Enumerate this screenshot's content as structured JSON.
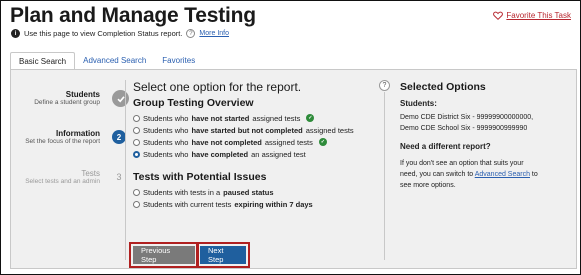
{
  "header": {
    "title": "Plan and Manage Testing",
    "subtitle": "Use this page to view Completion Status report.",
    "more_info": "More Info",
    "favorite": "Favorite This Task"
  },
  "tabs": [
    {
      "label": "Basic Search",
      "active": true
    },
    {
      "label": "Advanced Search",
      "active": false
    },
    {
      "label": "Favorites",
      "active": false
    }
  ],
  "steps": [
    {
      "title": "Students",
      "sub": "Define a student group",
      "marker": "",
      "state": "done"
    },
    {
      "title": "Information",
      "sub": "Set the focus of the report",
      "marker": "2",
      "state": "current"
    },
    {
      "title": "Tests",
      "sub": "Select tests and an admin",
      "marker": "3",
      "state": "todo"
    }
  ],
  "main": {
    "heading": "Select one option for the report.",
    "group1_title": "Group Testing Overview",
    "group1_options": [
      {
        "pre": "Students who ",
        "bold": "have not started",
        "post": " assigned tests",
        "icon": true,
        "checked": false
      },
      {
        "pre": "Students who ",
        "bold": "have started but not completed",
        "post": " assigned tests",
        "icon": false,
        "checked": false
      },
      {
        "pre": "Students who ",
        "bold": "have not completed",
        "post": " assigned tests",
        "icon": true,
        "checked": false
      },
      {
        "pre": "Students who ",
        "bold": "have completed",
        "post": " an assigned test",
        "icon": false,
        "checked": true
      }
    ],
    "group2_title": "Tests with Potential Issues",
    "group2_options": [
      {
        "pre": "Students with tests in a ",
        "bold": "paused status",
        "post": "",
        "checked": false
      },
      {
        "pre": "Students with current tests ",
        "bold": "expiring within 7 days",
        "post": "",
        "checked": false
      }
    ]
  },
  "buttons": {
    "prev": "Previous Step",
    "next": "Next Step"
  },
  "selected": {
    "heading": "Selected Options",
    "students_label": "Students:",
    "line1": "Demo CDE District Six - 99999900000000,",
    "line2": "Demo CDE School Six - 9999900999990",
    "need_label": "Need a different report?",
    "p1": "If you don't see an option that suits your",
    "p2_pre": "need, you can switch to ",
    "p2_link": "Advanced Search",
    "p2_post": " to",
    "p3": "see more options."
  },
  "colors": {
    "primary": "#1f5f9e",
    "secondary_button": "#7a7a7a",
    "highlight_border": "#b02020",
    "check_icon": "#2e8b3a",
    "favorite": "#b7272f",
    "panel_bg": "#f0f0f0"
  },
  "icons": {
    "info": "info-icon",
    "help": "question-icon",
    "favorite": "heart-icon",
    "done_step": "checkmark-icon",
    "option_hint": "check-circle-icon"
  }
}
